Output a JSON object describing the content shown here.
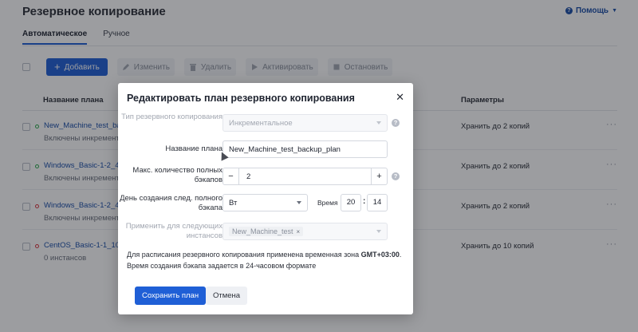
{
  "page": {
    "title": "Резервное копирование",
    "help_label": "Помощь",
    "tabs": [
      {
        "label": "Автоматическое",
        "active": true
      },
      {
        "label": "Ручное",
        "active": false
      }
    ]
  },
  "toolbar": {
    "add_label": "Добавить",
    "edit_label": "Изменить",
    "delete_label": "Удалить",
    "activate_label": "Активировать",
    "stop_label": "Остановить"
  },
  "table": {
    "headers": {
      "name": "Название плана",
      "params": "Параметры"
    },
    "rows": [
      {
        "name": "New_Machine_test_back",
        "sub": "Включены инкремента",
        "params": "Хранить до 2 копий",
        "status": "green"
      },
      {
        "name": "Windows_Basic-1-2_40G",
        "sub": "Включены инкремента",
        "params": "Хранить до 2 копий",
        "status": "green"
      },
      {
        "name": "Windows_Basic-1-2_40G",
        "sub": "Включены инкремента",
        "params": "Хранить до 2 копий",
        "status": "red"
      },
      {
        "name": "CentOS_Basic-1-1_10GB",
        "sub": "0 инстансов",
        "params": "Хранить до 10 копий",
        "status": "red"
      }
    ],
    "more": "···"
  },
  "modal": {
    "title": "Редактировать план резервного копирования",
    "close": "✕",
    "fields": {
      "backup_type": {
        "label": "Тип резервного копирования",
        "value": "Инкрементальное"
      },
      "plan_name": {
        "label": "Название плана",
        "value": "New_Machine_test_backup_plan"
      },
      "max_full": {
        "label": "Макс. количество полных бэкапов",
        "value": "2",
        "minus": "−",
        "plus": "+"
      },
      "day": {
        "label": "День создания след. полного бэкапа",
        "value": "Вт"
      },
      "time": {
        "label": "Время",
        "hour": "20",
        "minute": "14",
        "sep": ":"
      },
      "apply": {
        "label": "Применить для следующих инстансов",
        "chip": "New_Machine_test",
        "chip_remove": "×"
      }
    },
    "note_prefix": "Для расписания резервного копирования применена временная зона ",
    "note_zone": "GMT+03:00",
    "note_suffix": ".",
    "note_line2": "Время создания бэкапа задается в 24-часовом формате",
    "save_label": "Сохранить план",
    "cancel_label": "Отмена",
    "info_glyph": "?"
  },
  "colors": {
    "accent": "#1f5fd6",
    "link": "#1a4ea8",
    "status_green": "#2aa84a",
    "status_red": "#d9343e"
  }
}
